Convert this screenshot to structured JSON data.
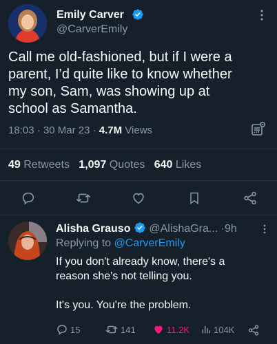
{
  "tweet": {
    "author_name": "Emily Carver",
    "author_handle": "@CarverEmily",
    "text_lines": [
      "Call me old-fashioned, but if I were a",
      "parent, I’d quite like to know whether",
      "my son, Sam, was showing up at",
      "school as Samantha."
    ],
    "time": "18:03",
    "date": "30 Mar 23",
    "views_count": "4.7M",
    "views_label": "Views",
    "sep": "·",
    "retweets_count": "49",
    "retweets_label": "Retweets",
    "quotes_count": "1,097",
    "quotes_label": "Quotes",
    "likes_count": "640",
    "likes_label": "Likes"
  },
  "reply": {
    "author_name": "Alisha Grauso",
    "author_handle": "@AlishaGra...",
    "age": "9h",
    "age_sep": "·",
    "replying_prefix": "Replying to",
    "replying_handle": "@CarverEmily",
    "text_lines": [
      "If you don't already know, there's a",
      "reason she's not telling you.",
      "",
      "It's you. You're the problem."
    ],
    "reply_count": "15",
    "retweet_count": "141",
    "like_count": "11.2K",
    "view_count": "104K"
  },
  "colors": {
    "background": "#15202b",
    "accent": "#1d9bf0",
    "like_pink": "#f91880",
    "muted": "#8b98a5"
  },
  "icons": [
    "verified-badge-icon",
    "more-icon",
    "analytics-icon",
    "reply-icon",
    "retweet-icon",
    "like-icon",
    "bookmark-icon",
    "share-icon",
    "views-icon"
  ]
}
